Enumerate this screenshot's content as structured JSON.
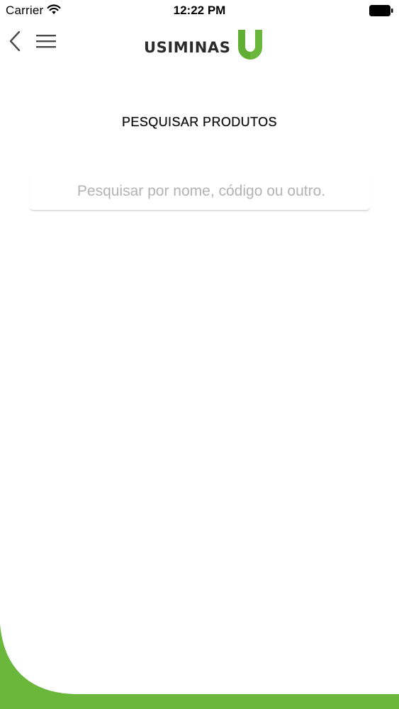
{
  "status_bar": {
    "carrier": "Carrier",
    "time": "12:22 PM"
  },
  "nav": {
    "back_icon": "chevron-left-icon",
    "menu_icon": "hamburger-menu-icon",
    "logo_text": "USIMINAS"
  },
  "page": {
    "title": "PESQUISAR PRODUTOS"
  },
  "search": {
    "value": "",
    "placeholder": "Pesquisar por nome, código ou outro."
  },
  "colors": {
    "brand_green": "#6ab73c",
    "text_dark": "#2b2b2b",
    "placeholder": "#b3b3b3"
  }
}
